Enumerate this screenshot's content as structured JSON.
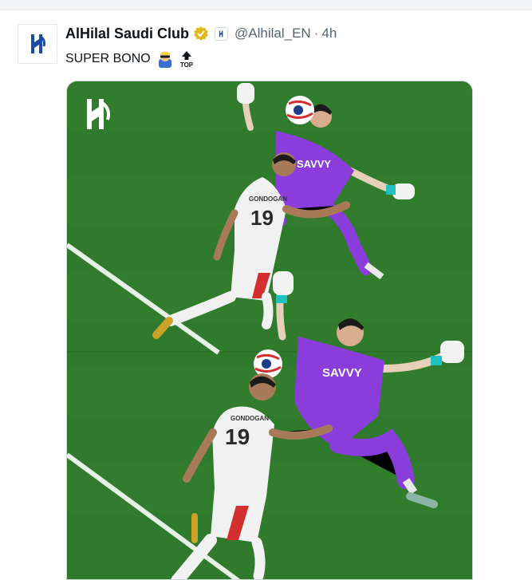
{
  "tweet": {
    "display_name": "AlHilal Saudi Club",
    "handle": "@Alhilal_EN",
    "separator": "·",
    "time": "4h",
    "text": "SUPER BONO",
    "emoji_top_label": "TOP"
  },
  "media": {
    "jersey_name": "GONDOGAN",
    "jersey_number": "19",
    "sponsor": "SAVVY"
  },
  "colors": {
    "pitch": "#2f7a2c",
    "keeper_kit": "#8a3ddb",
    "verified_badge": "#e2b719",
    "text_primary": "#0f1419",
    "text_secondary": "#536471",
    "brand": "#1c4da1"
  }
}
